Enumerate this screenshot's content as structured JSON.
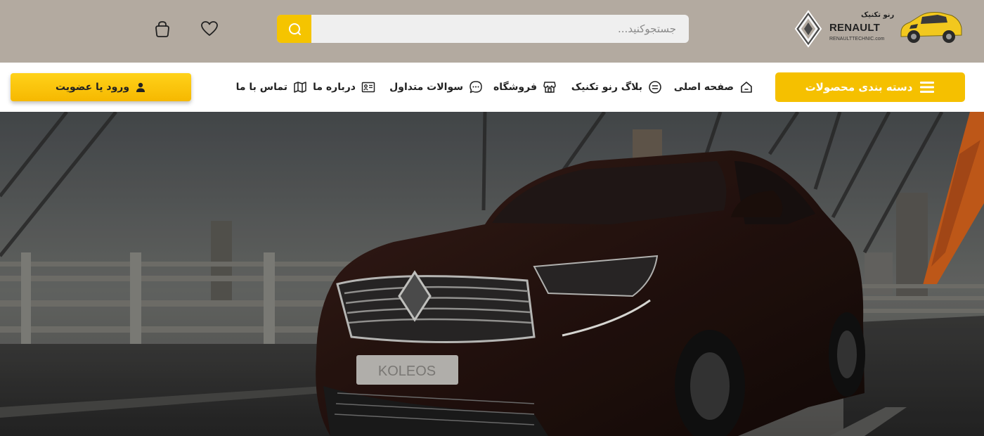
{
  "header": {
    "logo": {
      "brand_text": "RENAULT",
      "persian_text": "رنو تکنیک",
      "url_text": "RENAULTTECHNIC.com",
      "car_color": "#f2c81e"
    },
    "search": {
      "placeholder": "جستجوکنید...",
      "value": "",
      "button_icon": "search-icon",
      "button_color": "#f5c400"
    },
    "icons": {
      "wishlist": "heart-icon",
      "cart": "shopping-bag-icon"
    },
    "background_color": "#b3aaa0"
  },
  "nav": {
    "categories_button": {
      "label": "دسته بندی محصولات",
      "icon": "hamburger-menu-icon",
      "color": "#f5c000"
    },
    "menu": [
      {
        "label": "صفحه اصلی",
        "icon": "home-icon"
      },
      {
        "label": "بلاگ رنو تکنیک",
        "icon": "blog-icon"
      },
      {
        "label": "فروشگاه",
        "icon": "store-icon"
      },
      {
        "label": "سوالات متداول",
        "icon": "chat-bubble-icon"
      },
      {
        "label": "درباره ما",
        "icon": "id-card-icon"
      },
      {
        "label": "تماس با ما",
        "icon": "map-icon"
      }
    ],
    "login_button": {
      "label": "ورود یا عضویت",
      "icon": "user-icon"
    }
  },
  "hero": {
    "car_plate_text": "KOLEOS"
  }
}
